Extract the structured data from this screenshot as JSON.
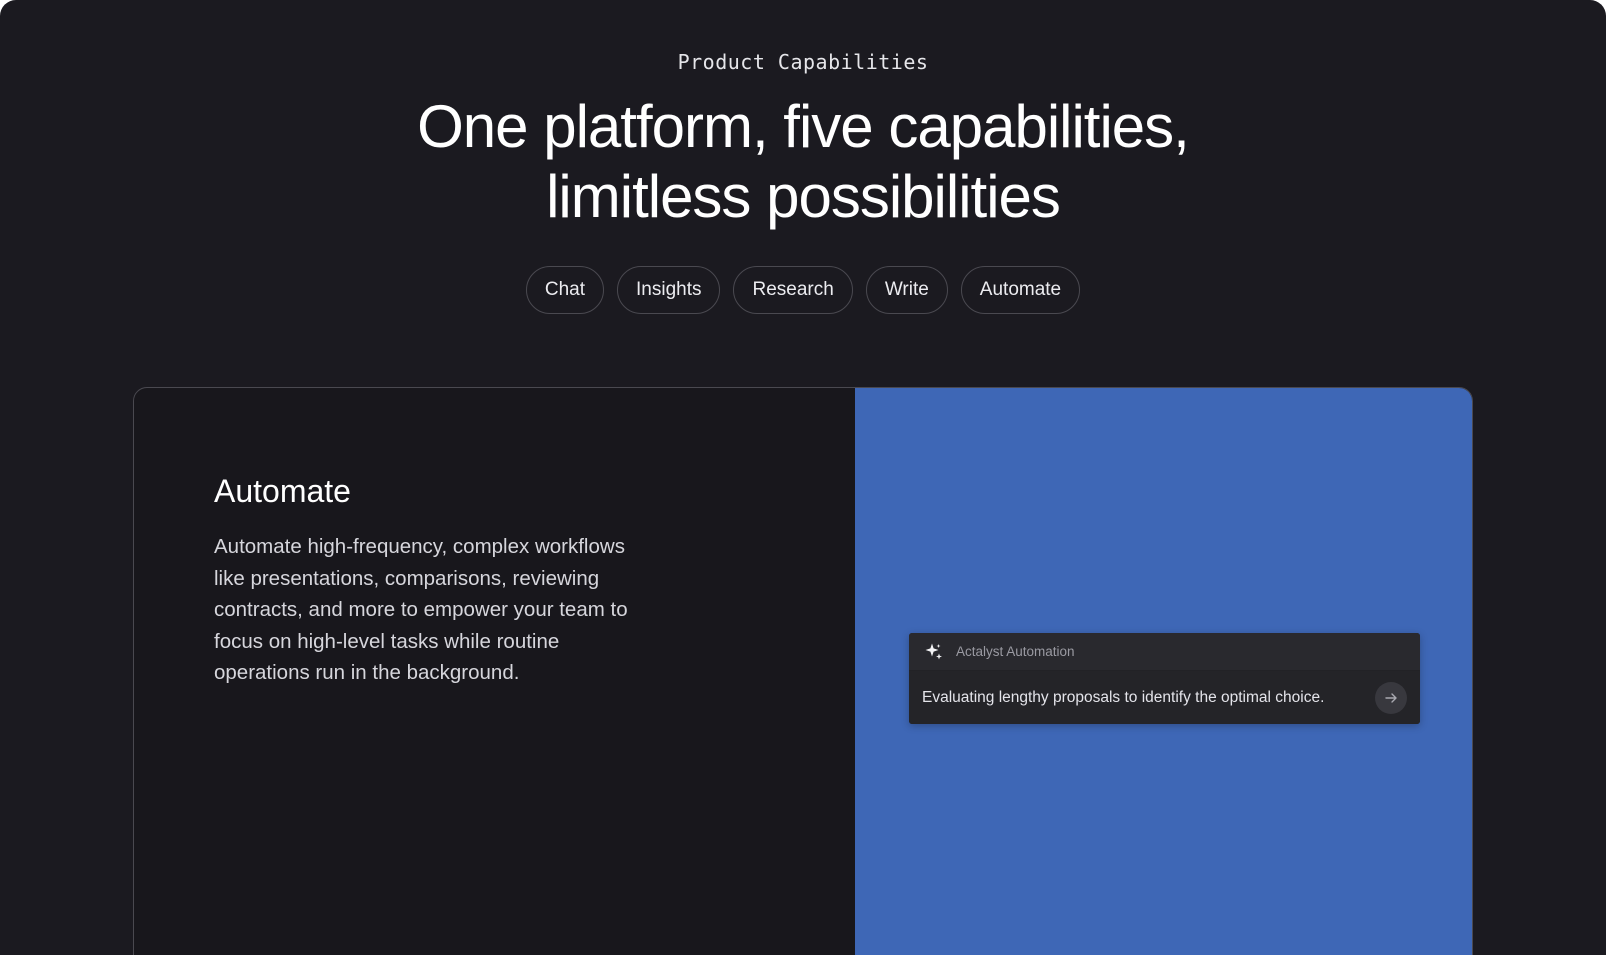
{
  "section": {
    "eyebrow": "Product Capabilities",
    "headline_line1": "One platform, five capabilities,",
    "headline_line2": "limitless possibilities"
  },
  "tabs": [
    {
      "label": "Chat"
    },
    {
      "label": "Insights"
    },
    {
      "label": "Research"
    },
    {
      "label": "Write"
    },
    {
      "label": "Automate"
    }
  ],
  "feature": {
    "title": "Automate",
    "description": "Automate high-frequency, complex workflows like presentations, comparisons, reviewing contracts, and more to empower your team to focus on high-level tasks while routine operations run in the background."
  },
  "automation_panel": {
    "name": "Actalyst Automation",
    "icon": "sparkle-icon",
    "prompt": "Evaluating lengthy proposals to identify the optimal choice.",
    "send_icon": "arrow-right-icon"
  },
  "colors": {
    "page_background": "#1b1a20",
    "card_background": "#18171c",
    "accent_blue": "#3e67b6",
    "panel_background": "#242428"
  }
}
